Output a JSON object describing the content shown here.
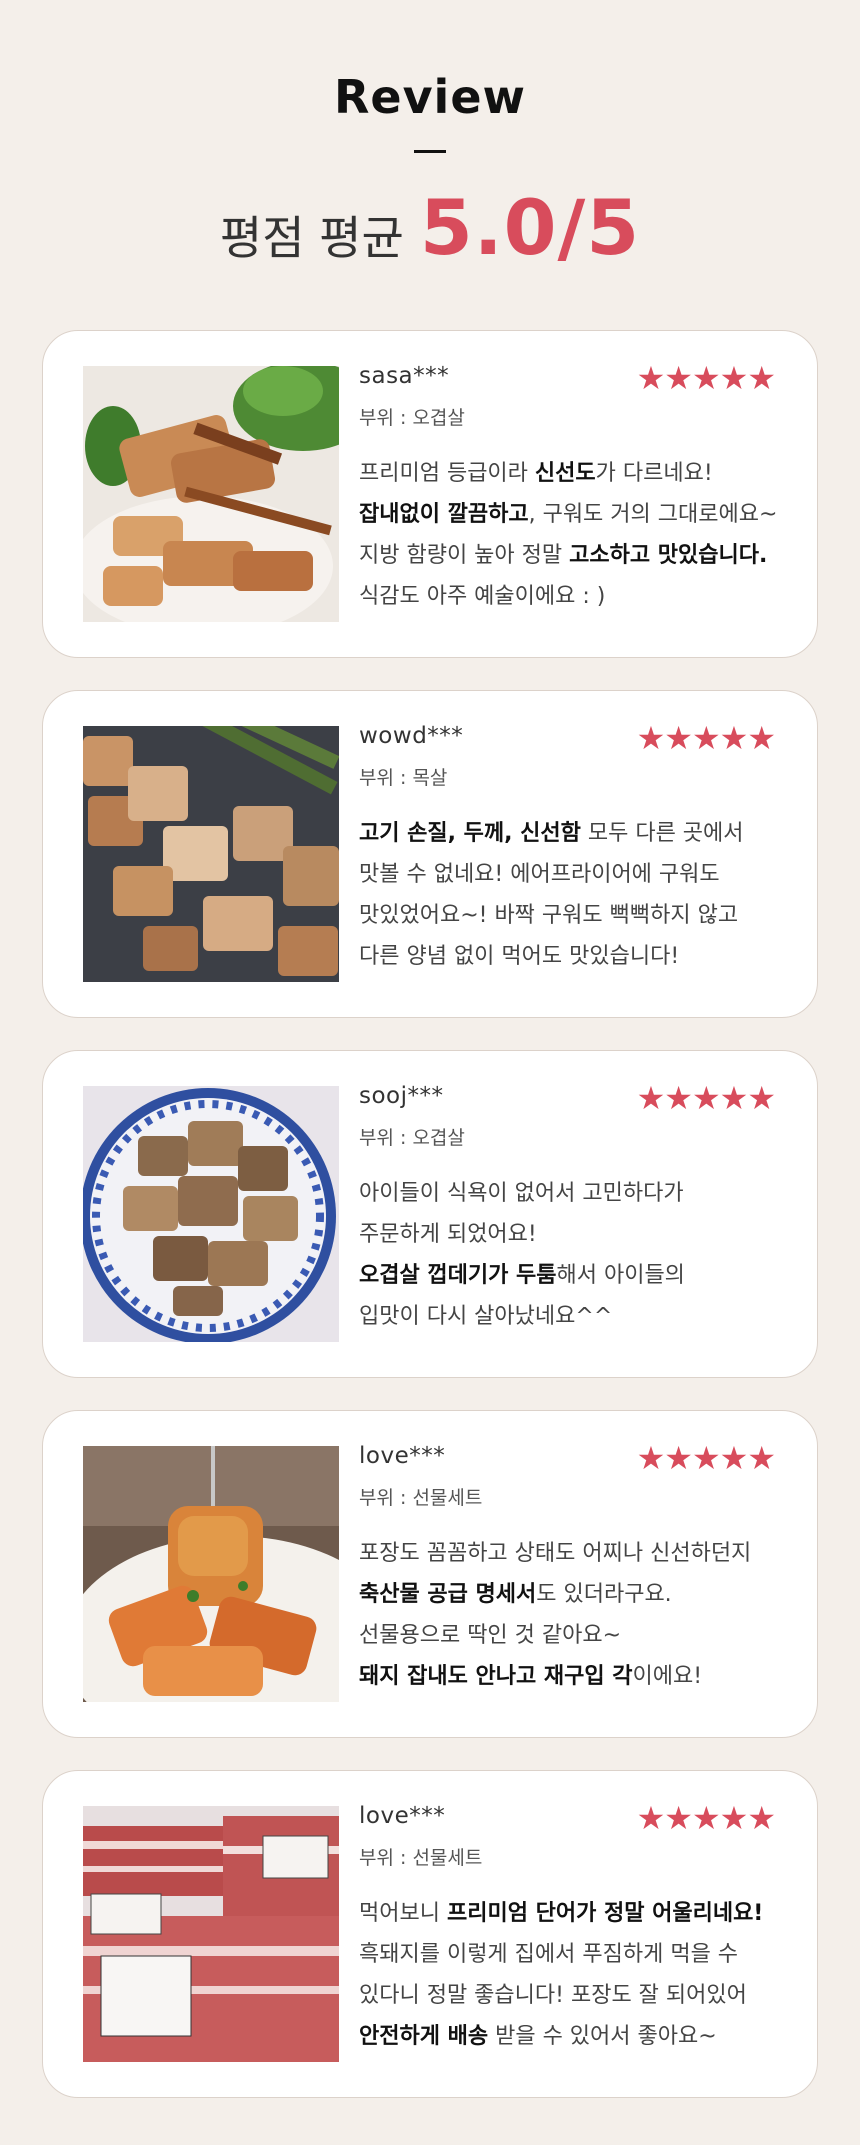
{
  "header": {
    "title": "Review",
    "avg_label": "평점 평균",
    "avg_score": "5.0/5"
  },
  "colors": {
    "accent": "#d84c5c",
    "background": "#f4efea",
    "card": "#ffffff"
  },
  "reviews": [
    {
      "name": "sasa***",
      "part": "부위 : 오겹살",
      "stars": "★★★★★",
      "rating": 5,
      "lines": [
        [
          {
            "t": "프리미엄 등급이라 "
          },
          {
            "t": "신선도",
            "b": true
          },
          {
            "t": "가 다르네요!"
          }
        ],
        [
          {
            "t": "잡내없이 깔끔하고",
            "b": true
          },
          {
            "t": ", 구워도 거의 그대로에요~"
          }
        ],
        [
          {
            "t": "지방 함량이 높아 정말 "
          },
          {
            "t": "고소하고 맛있습니다.",
            "b": true
          }
        ],
        [
          {
            "t": "식감도 아주 예술이에요 : )"
          }
        ]
      ]
    },
    {
      "name": "wowd***",
      "part": "부위 : 목살",
      "stars": "★★★★★",
      "rating": 5,
      "lines": [
        [
          {
            "t": "고기 손질, 두께, 신선함",
            "b": true
          },
          {
            "t": " 모두 다른 곳에서"
          }
        ],
        [
          {
            "t": "맛볼 수 없네요! 에어프라이어에 구워도"
          }
        ],
        [
          {
            "t": "맛있었어요~! 바짝 구워도 뻑뻑하지 않고"
          }
        ],
        [
          {
            "t": "다른 양념 없이 먹어도 맛있습니다!"
          }
        ]
      ]
    },
    {
      "name": "sooj***",
      "part": "부위 : 오겹살",
      "stars": "★★★★★",
      "rating": 5,
      "lines": [
        [
          {
            "t": "아이들이 식욕이 없어서 고민하다가"
          }
        ],
        [
          {
            "t": "주문하게 되었어요!"
          }
        ],
        [
          {
            "t": "오겹살 껍데기가 두툼",
            "b": true
          },
          {
            "t": "해서 아이들의"
          }
        ],
        [
          {
            "t": "입맛이 다시 살아났네요^^"
          }
        ]
      ]
    },
    {
      "name": "love***",
      "part": "부위 : 선물세트",
      "stars": "★★★★★",
      "rating": 5,
      "lines": [
        [
          {
            "t": "포장도 꼼꼼하고 상태도 어찌나 신선하던지"
          }
        ],
        [
          {
            "t": "축산물 공급 명세서",
            "b": true
          },
          {
            "t": "도 있더라구요."
          }
        ],
        [
          {
            "t": "선물용으로 딱인 것 같아요~"
          }
        ],
        [
          {
            "t": "돼지 잡내도 안나고 재구입 각",
            "b": true
          },
          {
            "t": "이에요!"
          }
        ]
      ]
    },
    {
      "name": "love***",
      "part": "부위 : 선물세트",
      "stars": "★★★★★",
      "rating": 5,
      "lines": [
        [
          {
            "t": "먹어보니 "
          },
          {
            "t": "프리미엄 단어가 정말 어울리네요!",
            "b": true
          }
        ],
        [
          {
            "t": "흑돼지를 이렇게 집에서 푸짐하게 먹을 수"
          }
        ],
        [
          {
            "t": "있다니 정말 좋습니다! 포장도 잘 되어있어"
          }
        ],
        [
          {
            "t": "안전하게 배송",
            "b": true
          },
          {
            "t": " 받을 수 있어서 좋아요~"
          }
        ]
      ]
    }
  ]
}
